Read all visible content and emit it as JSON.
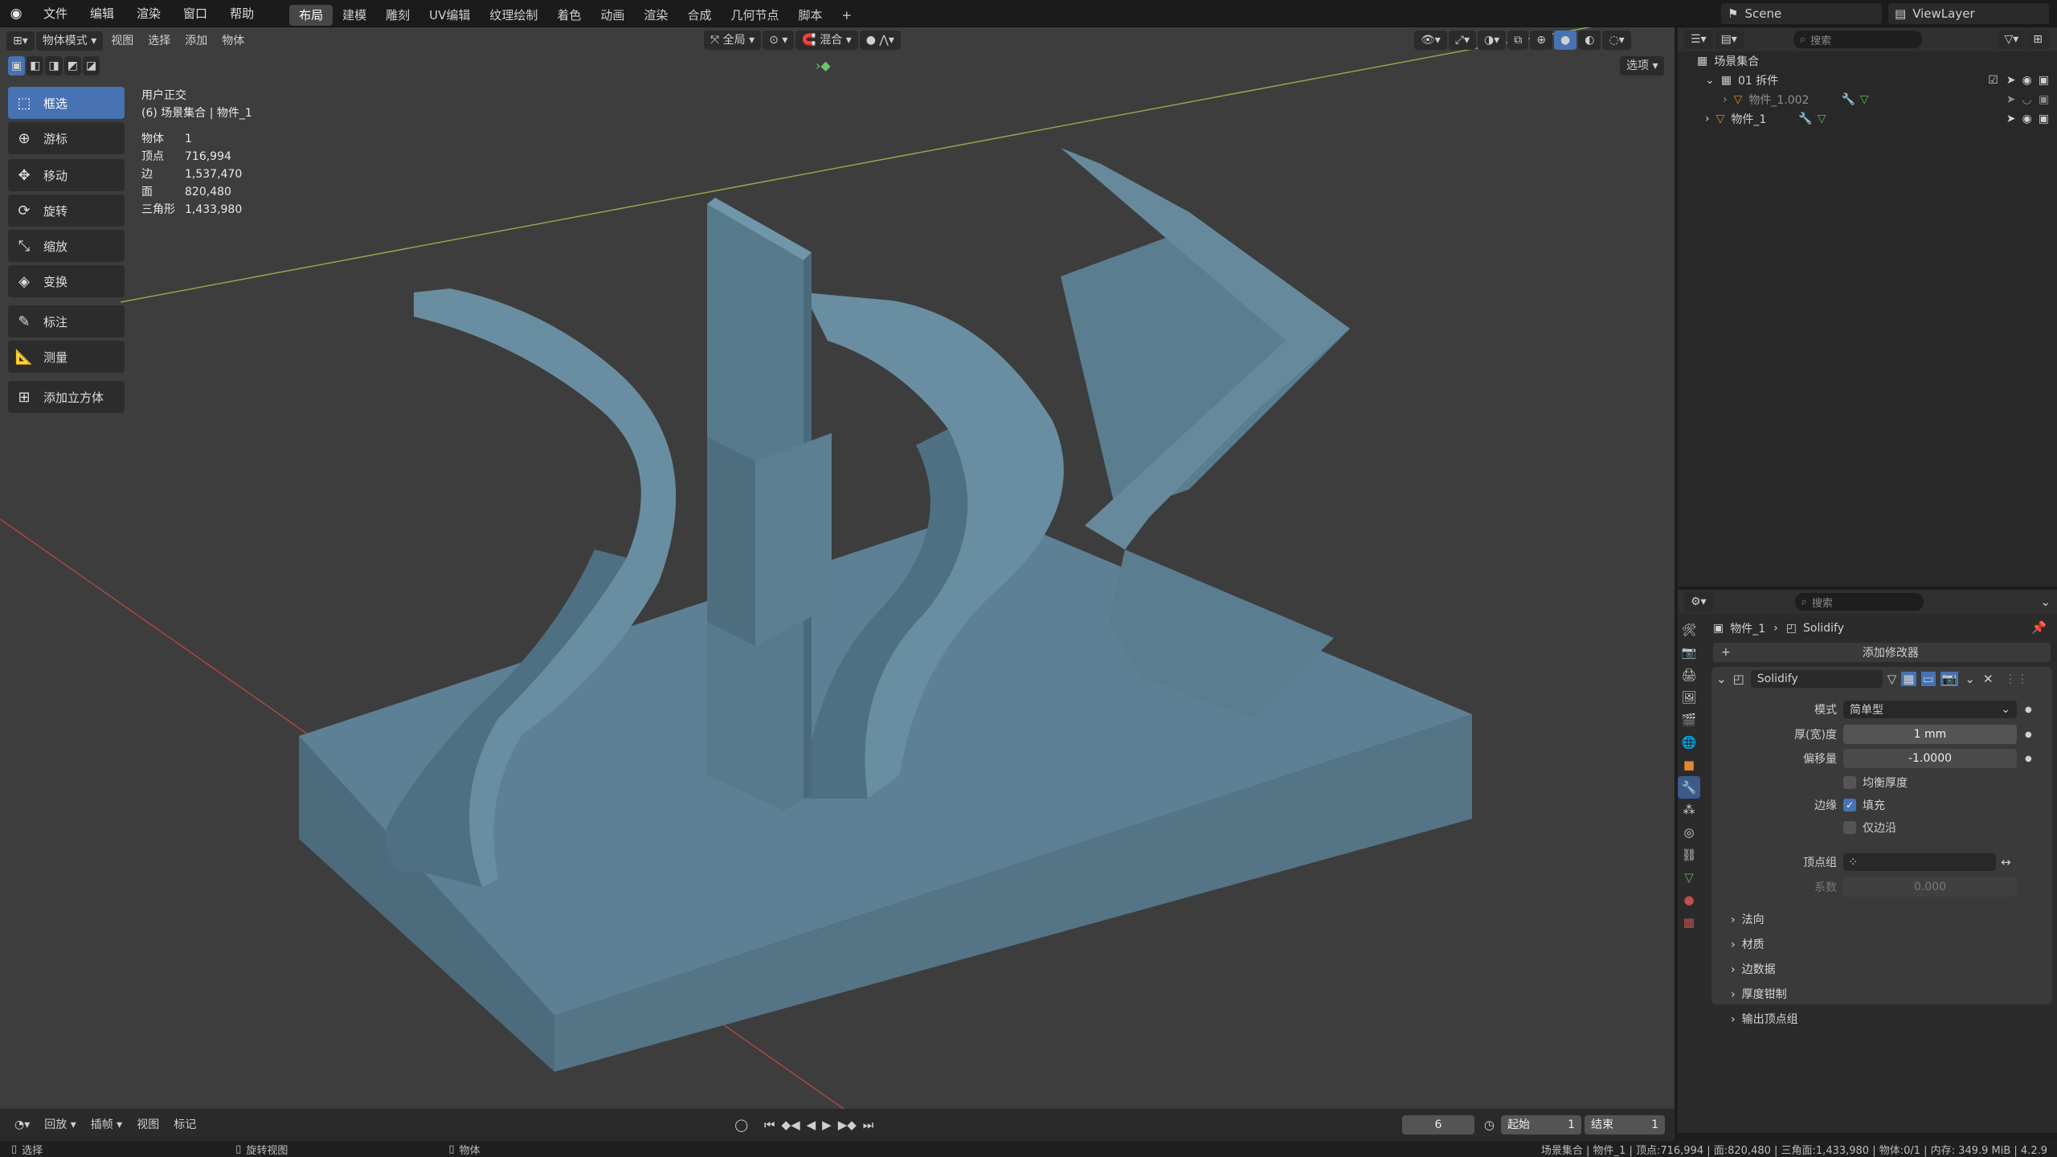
{
  "topbar": {
    "menus": [
      "文件",
      "编辑",
      "渲染",
      "窗口",
      "帮助"
    ],
    "tabs": [
      "布局",
      "建模",
      "雕刻",
      "UV编辑",
      "纹理绘制",
      "着色",
      "动画",
      "渲染",
      "合成",
      "几何节点",
      "脚本"
    ],
    "active_tab": "布局",
    "scene": "Scene",
    "viewlayer": "ViewLayer"
  },
  "viewport": {
    "mode": "物体模式",
    "menus": [
      "视图",
      "选择",
      "添加",
      "物体"
    ],
    "transform_orientation": "全局",
    "blend": "混合",
    "options": "选项",
    "view_name": "用户正交",
    "collection_path": "(6) 场景集合 | 物件_1",
    "stats": [
      {
        "label": "物体",
        "value": "1"
      },
      {
        "label": "顶点",
        "value": "716,994"
      },
      {
        "label": "边",
        "value": "1,537,470"
      },
      {
        "label": "面",
        "value": "820,480"
      },
      {
        "label": "三角形",
        "value": "1,433,980"
      }
    ]
  },
  "tools": [
    {
      "label": "框选",
      "icon": "select-box-icon",
      "active": true
    },
    {
      "label": "游标",
      "icon": "cursor-icon"
    },
    {
      "label": "移动",
      "icon": "move-icon"
    },
    {
      "label": "旋转",
      "icon": "rotate-icon"
    },
    {
      "label": "缩放",
      "icon": "scale-icon"
    },
    {
      "label": "变换",
      "icon": "transform-icon"
    },
    {
      "label": "标注",
      "icon": "annotate-icon"
    },
    {
      "label": "测量",
      "icon": "measure-icon"
    },
    {
      "label": "添加立方体",
      "icon": "add-cube-icon"
    }
  ],
  "outliner": {
    "search_placeholder": "搜索",
    "root": "场景集合",
    "items": [
      {
        "label": "01 拆件",
        "level": 1
      },
      {
        "label": "物件_1.002",
        "level": 2
      },
      {
        "label": "物件_1",
        "level": 1
      }
    ]
  },
  "properties": {
    "search_placeholder": "搜索",
    "breadcrumb_object": "物件_1",
    "breadcrumb_modifier": "Solidify",
    "add_modifier": "添加修改器",
    "modifier_name": "Solidify",
    "mode_label": "模式",
    "mode_value": "简单型",
    "thickness_label": "厚(宽)度",
    "thickness_value": "1 mm",
    "offset_label": "偏移量",
    "offset_value": "-1.0000",
    "even_thickness": "均衡厚度",
    "rim_label": "边缘",
    "rim_fill": "填充",
    "rim_only": "仅边沿",
    "vgroup_label": "顶点组",
    "factor_label": "系数",
    "factor_value": "0.000",
    "subpanels": [
      "法向",
      "材质",
      "边数据",
      "厚度钳制",
      "输出顶点组"
    ]
  },
  "timeline": {
    "menus": [
      "回放",
      "插帧",
      "视图",
      "标记"
    ],
    "current_frame": "6",
    "start_label": "起始",
    "start_value": "1",
    "end_label": "结束",
    "end_value": "1"
  },
  "statusbar": {
    "left": [
      "选择",
      "旋转视图",
      "物体"
    ],
    "right": "场景集合 | 物件_1 | 顶点:716,994 | 面:820,480 | 三角面:1,433,980 | 物体:0/1 | 内存: 349.9 MiB | 4.2.9"
  },
  "colors": {
    "accent": "#4772b3",
    "model": "#5c8093",
    "viewport": "#3d3d3d"
  }
}
